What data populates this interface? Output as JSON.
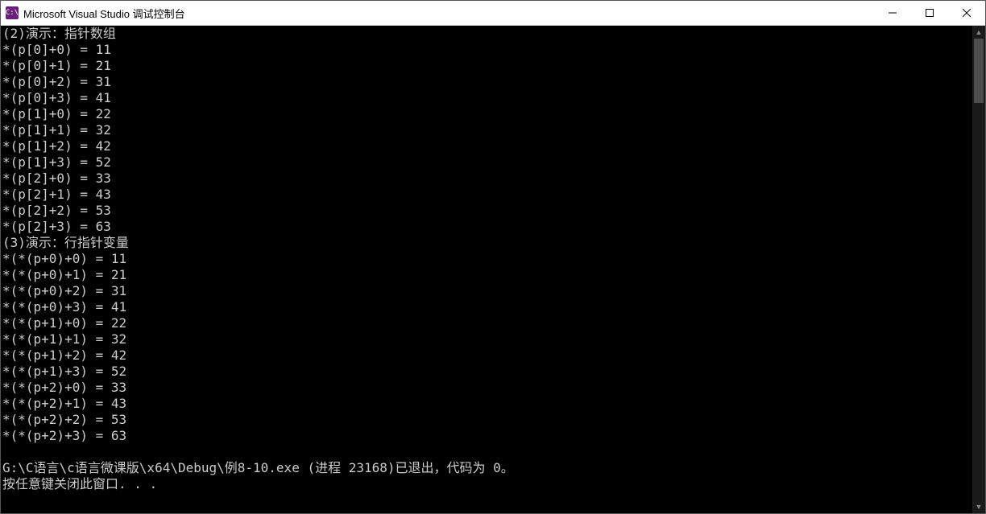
{
  "window": {
    "title": "Microsoft Visual Studio 调试控制台",
    "icon_label": "C:\\"
  },
  "console": {
    "lines": [
      "(2)演示：指针数组",
      "*(p[0]+0) = 11",
      "*(p[0]+1) = 21",
      "*(p[0]+2) = 31",
      "*(p[0]+3) = 41",
      "*(p[1]+0) = 22",
      "*(p[1]+1) = 32",
      "*(p[1]+2) = 42",
      "*(p[1]+3) = 52",
      "*(p[2]+0) = 33",
      "*(p[2]+1) = 43",
      "*(p[2]+2) = 53",
      "*(p[2]+3) = 63",
      "(3)演示：行指针变量",
      "*(*(p+0)+0) = 11",
      "*(*(p+0)+1) = 21",
      "*(*(p+0)+2) = 31",
      "*(*(p+0)+3) = 41",
      "*(*(p+1)+0) = 22",
      "*(*(p+1)+1) = 32",
      "*(*(p+1)+2) = 42",
      "*(*(p+1)+3) = 52",
      "*(*(p+2)+0) = 33",
      "*(*(p+2)+1) = 43",
      "*(*(p+2)+2) = 53",
      "*(*(p+2)+3) = 63",
      "",
      "G:\\C语言\\c语言微课版\\x64\\Debug\\例8-10.exe (进程 23168)已退出，代码为 0。",
      "按任意键关闭此窗口. . ."
    ]
  }
}
